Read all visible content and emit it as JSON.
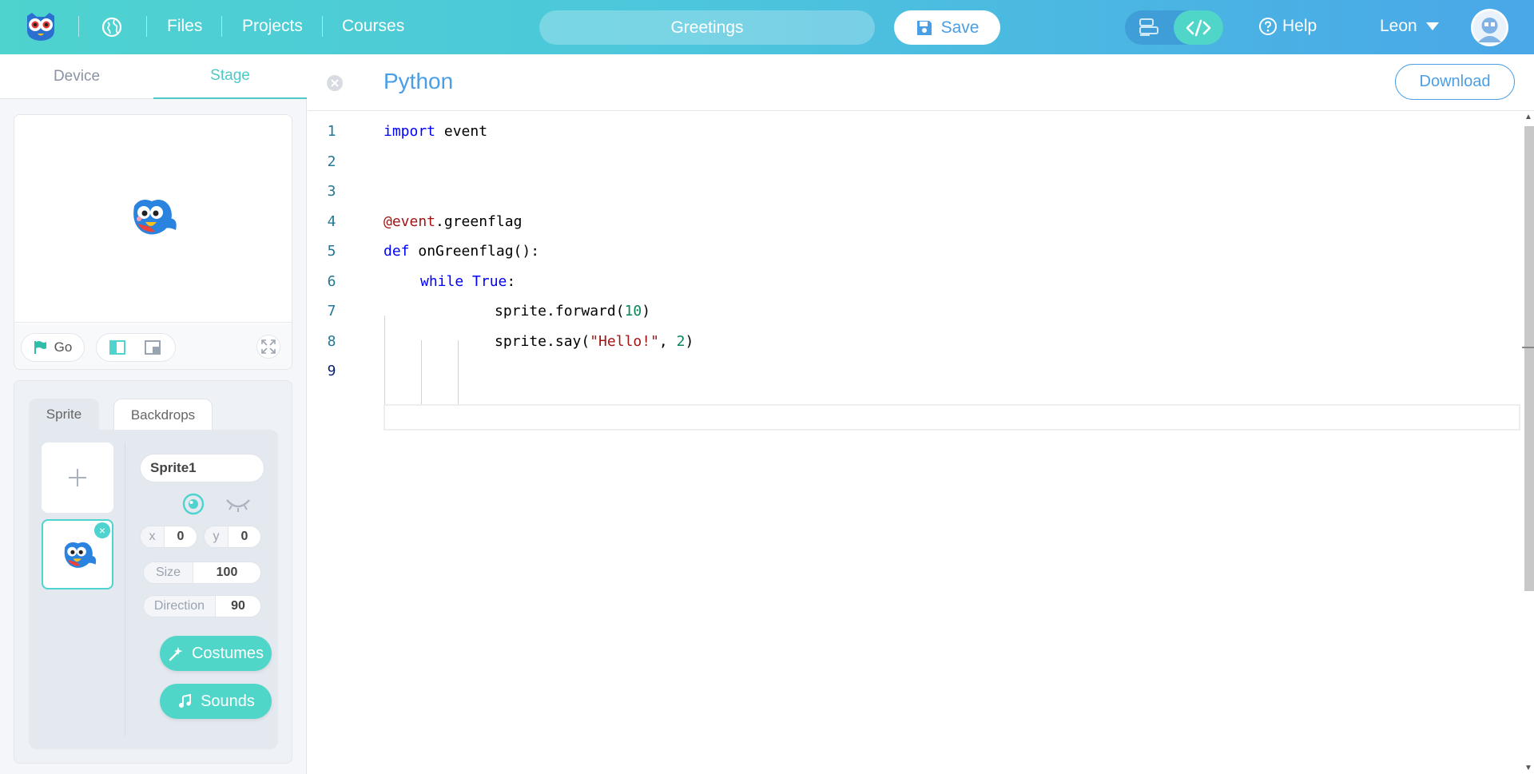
{
  "topbar": {
    "nav": [
      "Files",
      "Projects",
      "Courses"
    ],
    "project_title": "Greetings",
    "save_label": "Save",
    "help_label": "Help",
    "user_name": "Leon"
  },
  "left_tabs": {
    "device": "Device",
    "stage": "Stage"
  },
  "stage": {
    "go_label": "Go"
  },
  "sprite_panel": {
    "tabs": {
      "sprite": "Sprite",
      "backdrops": "Backdrops"
    },
    "name": "Sprite1",
    "x_label": "x",
    "x_value": "0",
    "y_label": "y",
    "y_value": "0",
    "size_label": "Size",
    "size_value": "100",
    "direction_label": "Direction",
    "direction_value": "90",
    "costumes_label": "Costumes",
    "sounds_label": "Sounds"
  },
  "editor": {
    "title": "Python",
    "download_label": "Download",
    "line_numbers": [
      "1",
      "2",
      "3",
      "4",
      "5",
      "6",
      "7",
      "8",
      "9"
    ],
    "code": {
      "l1_kw": "import",
      "l1_rest": " event",
      "l4_at": "@event",
      "l4_rest": ".greenflag",
      "l5_kw": "def",
      "l5_rest": " onGreenflag():",
      "l6_kw1": "while",
      "l6_kw2": "True",
      "l6_rest": ":",
      "l7_a": "sprite.forward(",
      "l7_num": "10",
      "l7_b": ")",
      "l8_a": "sprite.say(",
      "l8_str": "\"Hello!\"",
      "l8_b": ", ",
      "l8_num": "2",
      "l8_c": ")"
    }
  },
  "colors": {
    "accent": "#4ed3cf",
    "blue": "#4a9ee6"
  }
}
